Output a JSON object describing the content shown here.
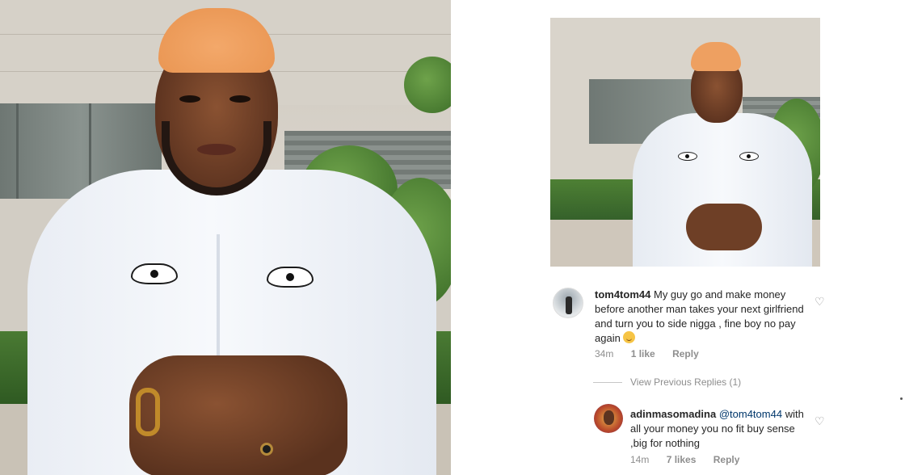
{
  "comments": [
    {
      "username": "tom4tom44",
      "text": "My guy go and make money before another man takes your next girlfriend and turn you to side nigga , fine boy no pay again",
      "emoji": "grinning-emoji",
      "time": "34m",
      "likes": "1 like",
      "reply_label": "Reply"
    },
    {
      "username": "adinmasomadina",
      "mention": "@tom4tom44",
      "text": "with all your money you no fit buy sense ,big for nothing",
      "time": "14m",
      "likes": "7 likes",
      "reply_label": "Reply"
    }
  ],
  "view_previous_replies": "View Previous Replies (1)",
  "icons": {
    "like": "heart-icon",
    "emoji": "smiling-emoji-icon"
  },
  "colors": {
    "meta_text": "#8e8e8e",
    "mention": "#00376b",
    "hair": "#ee9f5c",
    "shirt": "#f2f5f9"
  }
}
